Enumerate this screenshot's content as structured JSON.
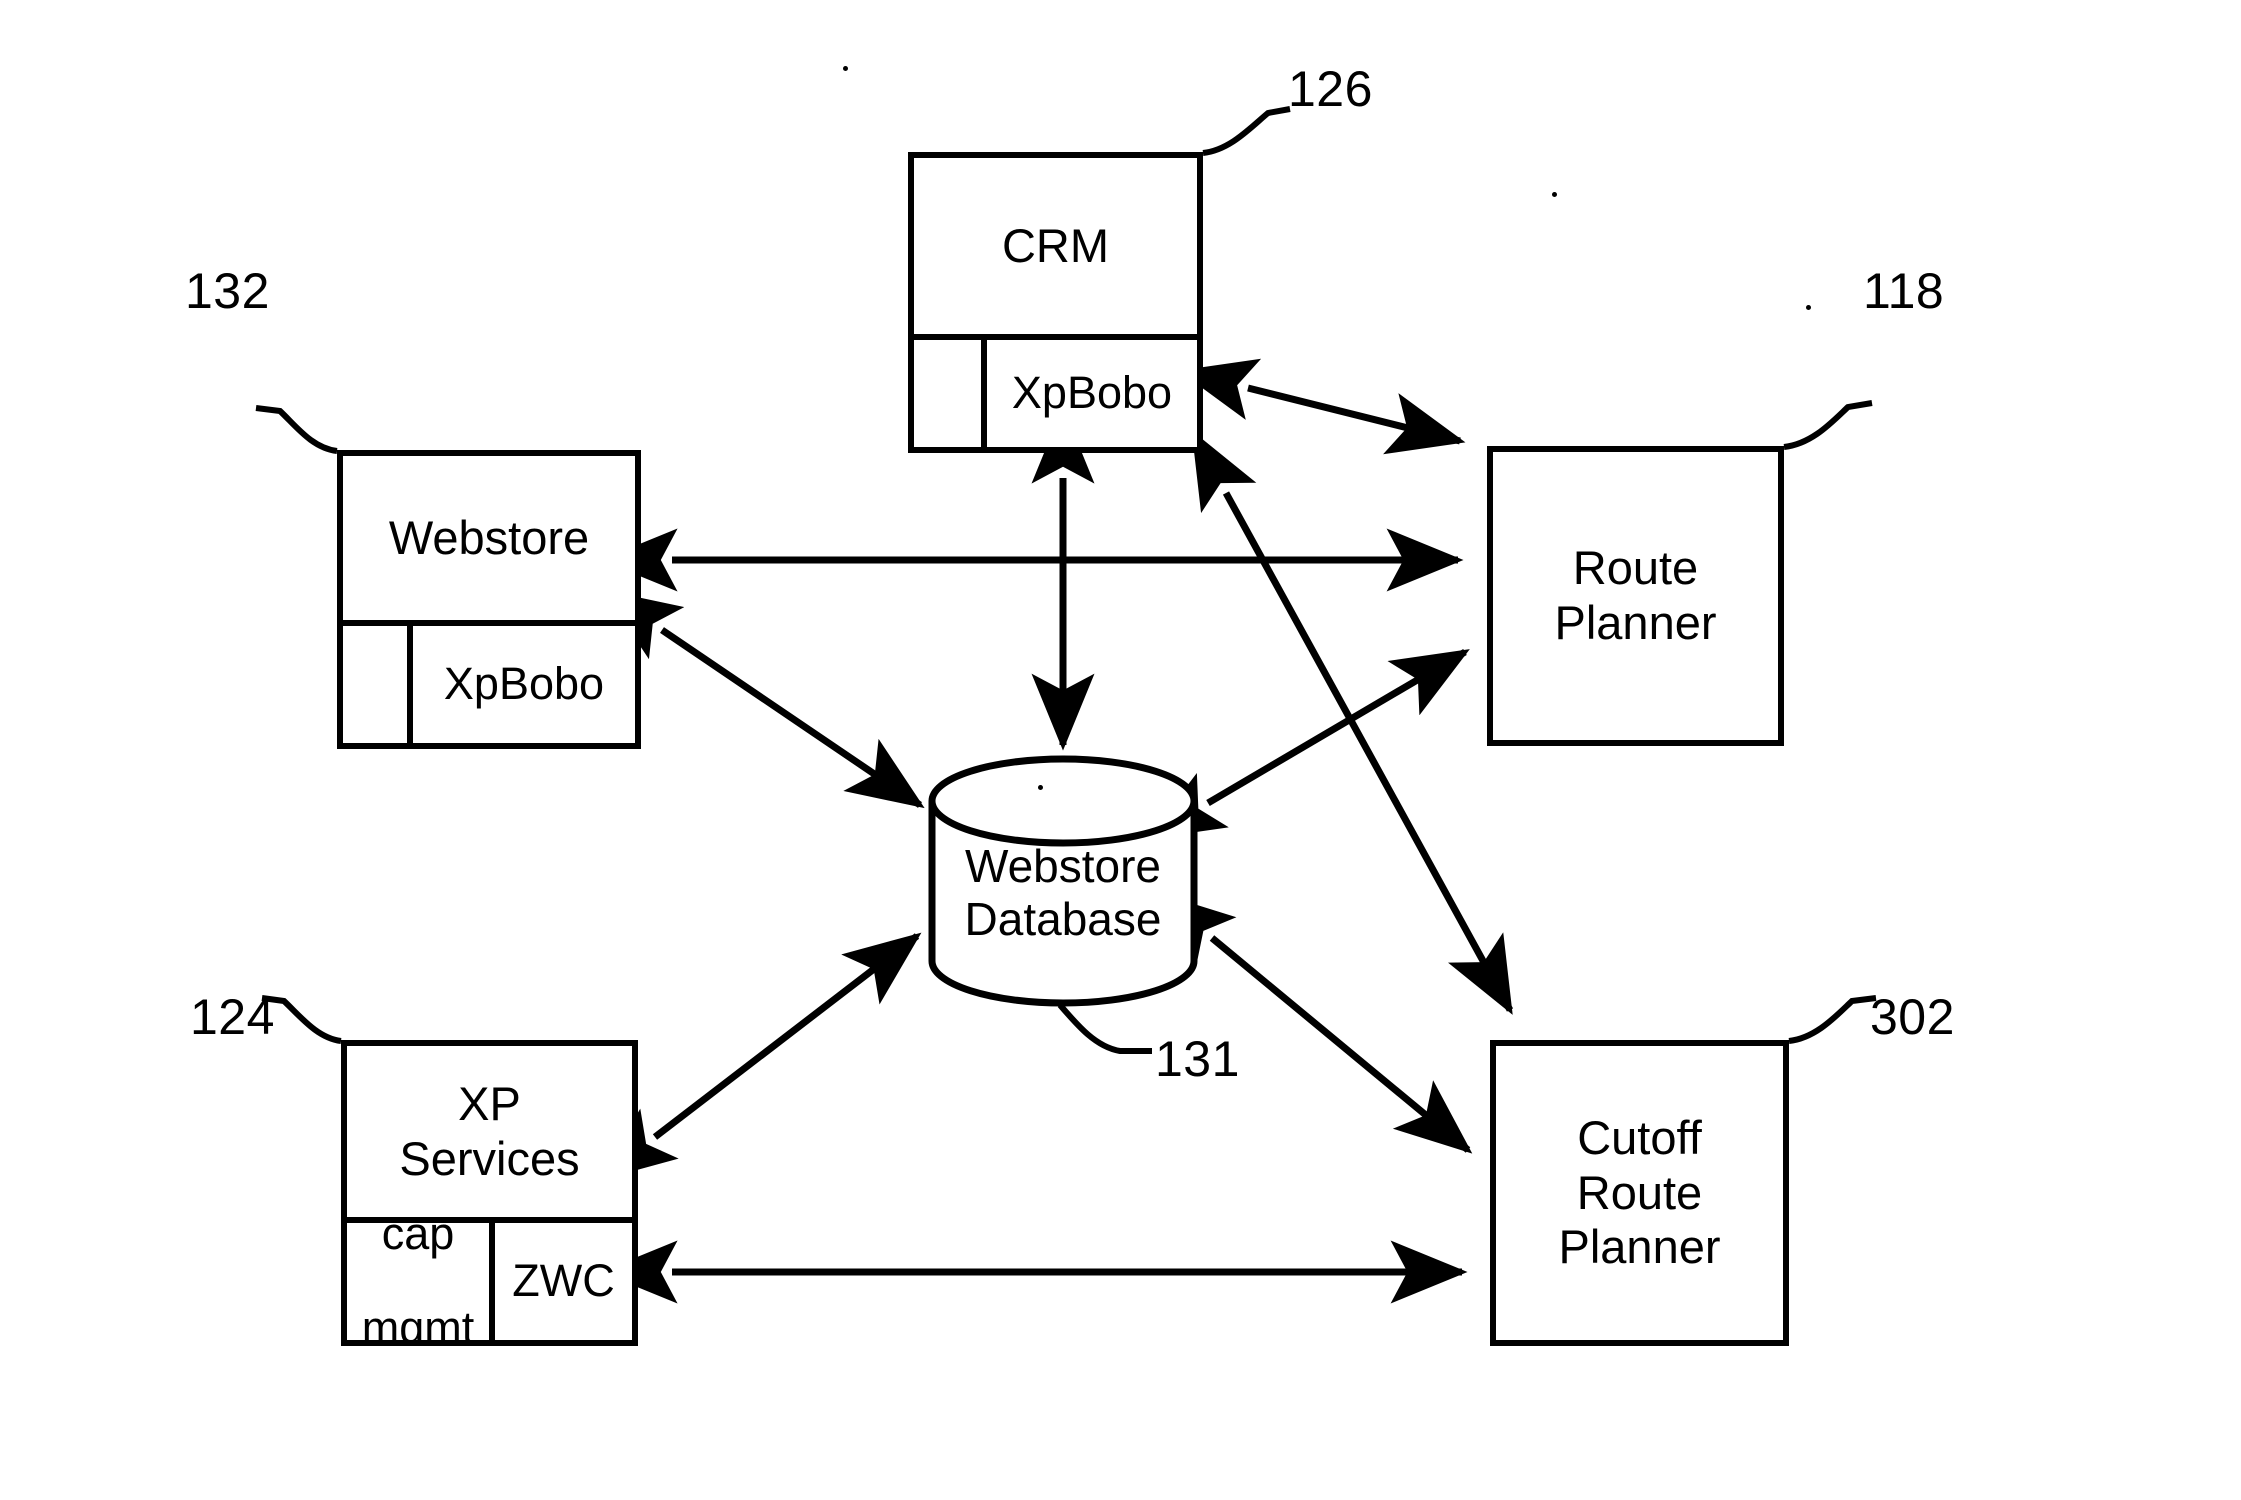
{
  "figure": {
    "type": "patent-system-architecture-diagram",
    "background_color": "#ffffff",
    "line_color": "#000000"
  },
  "nodes": {
    "crm": {
      "label": "CRM",
      "reference_numeral": "126",
      "sub_left_label": "",
      "sub_right_label": "XpBobo"
    },
    "webstore": {
      "label": "Webstore",
      "reference_numeral": "132",
      "sub_left_label": "",
      "sub_right_label": "XpBobo"
    },
    "route_planner": {
      "label_line1": "Route",
      "label_line2": "Planner",
      "reference_numeral": "118"
    },
    "xp_services": {
      "label_line1": "XP",
      "label_line2": "Services",
      "reference_numeral": "124",
      "sub_left_line1": "cap",
      "sub_left_line2": "mgmt",
      "sub_right_label": "ZWC"
    },
    "cutoff_route_planner": {
      "label_line1": "Cutoff",
      "label_line2": "Route",
      "label_line3": "Planner",
      "reference_numeral": "302"
    },
    "database": {
      "label_line1": "Webstore",
      "label_line2": "Database",
      "reference_numeral": "131"
    }
  },
  "connections": [
    {
      "id": "crm-route-planner",
      "from": "crm",
      "to": "route_planner",
      "style": "double-headed"
    },
    {
      "id": "webstore-route-planner",
      "from": "webstore",
      "to": "route_planner",
      "style": "double-headed"
    },
    {
      "id": "crm-database",
      "from": "crm",
      "to": "database",
      "style": "double-headed"
    },
    {
      "id": "webstore-database",
      "from": "webstore",
      "to": "database",
      "style": "double-headed"
    },
    {
      "id": "database-route-planner",
      "from": "database",
      "to": "route_planner",
      "style": "double-headed"
    },
    {
      "id": "crm-cutoff-route-planner",
      "from": "crm",
      "to": "cutoff_route_planner",
      "style": "double-headed"
    },
    {
      "id": "database-cutoff-route-planner",
      "from": "database",
      "to": "cutoff_route_planner",
      "style": "double-headed"
    },
    {
      "id": "xp-services-database",
      "from": "xp_services",
      "to": "database",
      "style": "double-headed"
    },
    {
      "id": "xp-services-cutoff-route-planner",
      "from": "xp_services",
      "to": "cutoff_route_planner",
      "style": "double-headed"
    }
  ]
}
